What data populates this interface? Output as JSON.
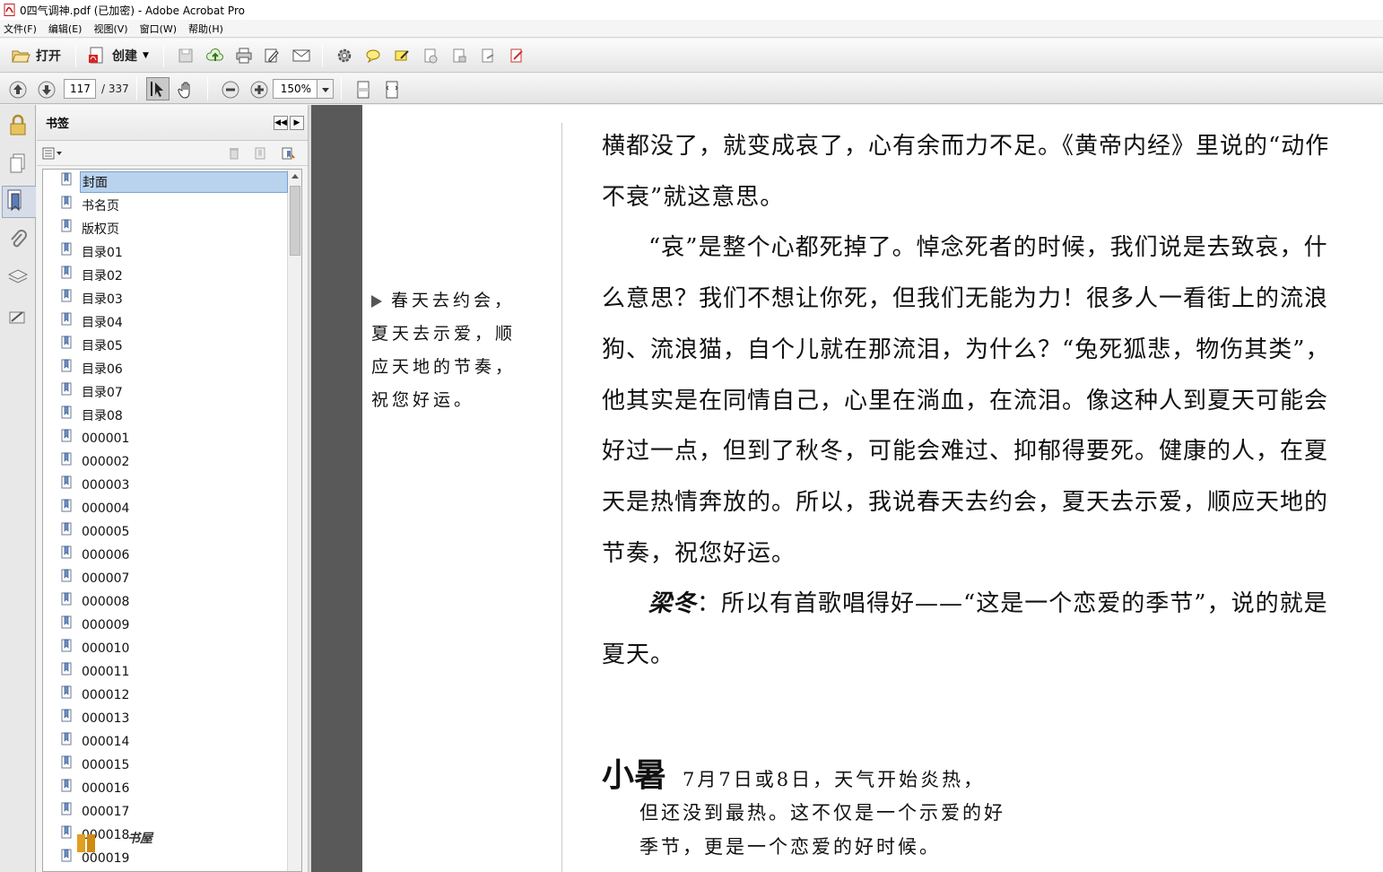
{
  "window": {
    "title": "0四气调神.pdf  (已加密)  - Adobe Acrobat Pro"
  },
  "menu": [
    "文件(F)",
    "编辑(E)",
    "视图(V)",
    "窗口(W)",
    "帮助(H)"
  ],
  "toolbar": {
    "open_label": "打开",
    "create_label": "创建"
  },
  "nav": {
    "page_current": "117",
    "page_total": "/ 337",
    "zoom": "150%"
  },
  "bookmarks": {
    "title": "书签",
    "items": [
      "封面",
      "书名页",
      "版权页",
      "目录01",
      "目录02",
      "目录03",
      "目录04",
      "目录05",
      "目录06",
      "目录07",
      "目录08",
      "000001",
      "000002",
      "000003",
      "000004",
      "000005",
      "000006",
      "000007",
      "000008",
      "000009",
      "000010",
      "000011",
      "000012",
      "000013",
      "000014",
      "000015",
      "000016",
      "000017",
      "000018",
      "000019"
    ],
    "selected_index": 0
  },
  "document": {
    "margin_note": "春天去约会，夏天去示爱，顺应天地的节奏，祝您好运。",
    "paragraphs": [
      "横都没了，就变成哀了，心有余而力不足。《黄帝内经》里说的“动作不衰”就这意思。",
      "“哀”是整个心都死掉了。悼念死者的时候，我们说是去致哀，什么意思？我们不想让你死，但我们无能为力！很多人一看街上的流浪狗、流浪猫，自个儿就在那流泪，为什么？“兔死狐悲，物伤其类”，他其实是在同情自己，心里在淌血，在流泪。像这种人到夏天可能会好过一点，但到了秋冬，可能会难过、抑郁得要死。健康的人，在夏天是热情奔放的。所以，我说春天去约会，夏天去示爱，顺应天地的节奏，祝您好运。"
    ],
    "speaker": "梁冬",
    "speaker_text": "：所以有首歌唱得好——“这是一个恋爱的季节”，说的就是夏天。",
    "section_title": "小暑",
    "section_line1": "7月7日或8日，天气开始炎热，",
    "section_line2": "但还没到最热。这不仅是一个示爱的好",
    "section_line3": "季节，更是一个恋爱的好时候。"
  },
  "watermark": "书屋"
}
